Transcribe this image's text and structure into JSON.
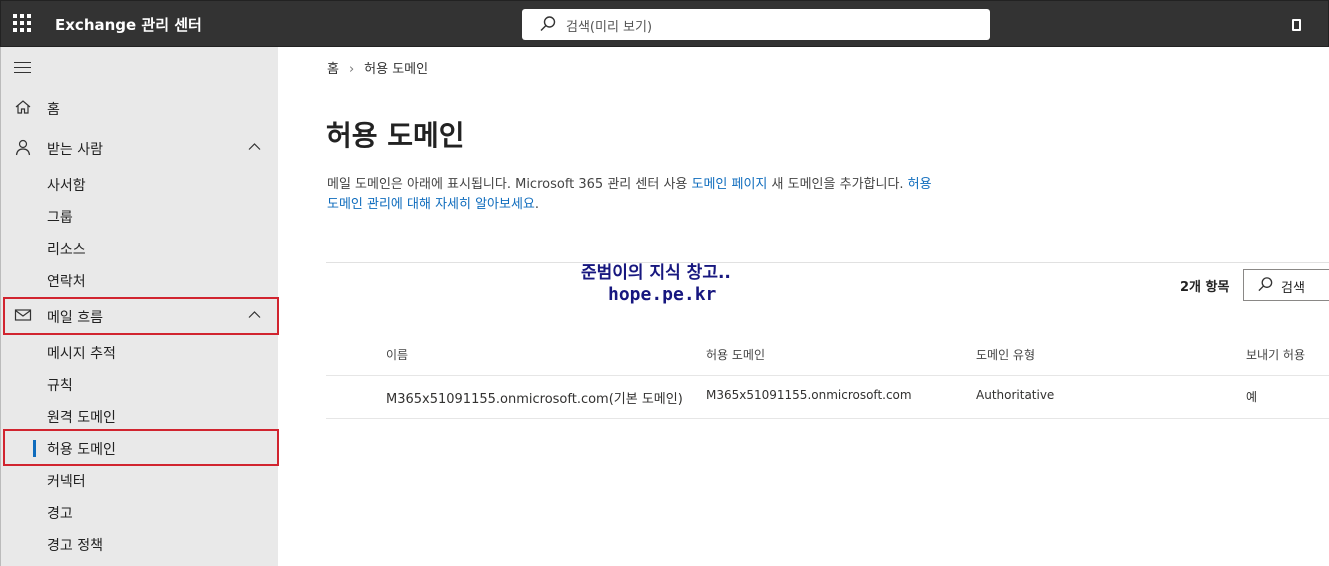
{
  "app": {
    "title": "Exchange 관리 센터",
    "search_placeholder": "검색(미리 보기)"
  },
  "sidebar": {
    "items": [
      {
        "label": "홈",
        "icon": "home-icon"
      },
      {
        "label": "받는 사람",
        "icon": "person-icon",
        "expanded": true,
        "children": [
          "사서함",
          "그룹",
          "리소스",
          "연락처"
        ]
      },
      {
        "label": "메일 흐름",
        "icon": "mail-icon",
        "expanded": true,
        "highlighted": true,
        "children": [
          "메시지 추적",
          "규칙",
          "원격 도메인",
          "허용 도메인",
          "커넥터",
          "경고",
          "경고 정책"
        ]
      }
    ],
    "selected_child": "허용 도메인"
  },
  "breadcrumb": {
    "home": "홈",
    "current": "허용 도메인"
  },
  "page": {
    "title": "허용 도메인",
    "desc_part1": "메일 도메인은 아래에 표시됩니다. Microsoft 365 관리 센터 사용 ",
    "desc_link1": "도메인 페이지",
    "desc_part2": " 새 도메인을 추가합니다. ",
    "desc_link2": "허용 도메인 관리에 대해 자세히 알아보세요",
    "desc_part3": "."
  },
  "watermark": {
    "line1": "준범이의 지식 창고..",
    "line2": "hope.pe.kr"
  },
  "toolbar": {
    "item_count": "2개 항목",
    "search_label": "검색"
  },
  "table": {
    "headers": [
      "이름",
      "허용 도메인",
      "도메인 유형",
      "보내기 허용"
    ],
    "rows": [
      [
        "M365x51091155.onmicrosoft.com(기본 도메인)",
        "M365x51091155.onmicrosoft.com",
        "Authoritative",
        "예"
      ]
    ]
  },
  "colors": {
    "topbar": "#333333",
    "sidebar": "#e9e9e9",
    "link": "#0f6cbd",
    "highlight_box": "#d1242f",
    "selection_bar": "#0f6cbd"
  }
}
